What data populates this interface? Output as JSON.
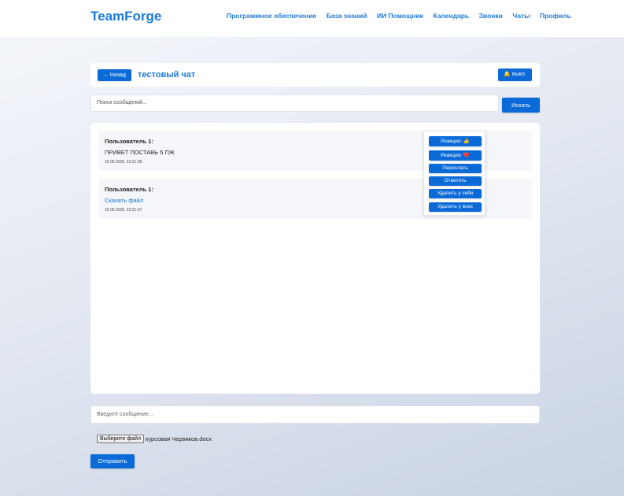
{
  "app": {
    "logo": "TeamForge"
  },
  "nav": {
    "items": [
      "Программное обеспечение",
      "База знаний",
      "ИИ Помощник",
      "Календарь",
      "Звонки",
      "Чаты",
      "Профиль"
    ]
  },
  "chat": {
    "back_label": "← Назад",
    "title": "тестовый чат",
    "notify_label": "выкл."
  },
  "search": {
    "placeholder": "Поиск сообщений...",
    "button_label": "Искать"
  },
  "messages": [
    {
      "author": "Пользователь 1:",
      "text": "ПРИВЕТ ПОСТАВЬ 5 ПЖ",
      "time": "16.05.2025, 23:21:28"
    },
    {
      "author": "Пользователь 1:",
      "link": "Скачать файл",
      "time": "16.05.2025, 23:21:37"
    }
  ],
  "context_menu": {
    "reaction_like": "Реакция: 👍",
    "reaction_heart": "Реакция: ❤️",
    "forward": "Переслать",
    "reply": "Ответить",
    "delete_self": "Удалить у себя",
    "delete_all": "Удалить у всех"
  },
  "compose": {
    "placeholder": "Введите сообщение...",
    "file_button": "Выберите файл",
    "file_name": "курсовая Червяков.docx",
    "send_label": "Отправить"
  },
  "colors": {
    "accent": "#0a6bd8",
    "logo": "#1a7be0",
    "link": "#1a73c8"
  }
}
